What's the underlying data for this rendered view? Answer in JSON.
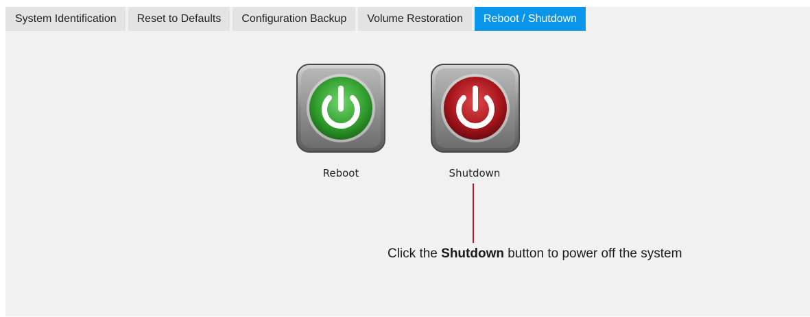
{
  "tabs": [
    {
      "label": "System Identification",
      "active": false
    },
    {
      "label": "Reset to Defaults",
      "active": false
    },
    {
      "label": "Configuration Backup",
      "active": false
    },
    {
      "label": "Volume Restoration",
      "active": false
    },
    {
      "label": "Reboot / Shutdown",
      "active": true
    }
  ],
  "buttons": {
    "reboot": {
      "label": "Reboot",
      "icon": "power-icon",
      "color": "#3fa83a"
    },
    "shutdown": {
      "label": "Shutdown",
      "icon": "power-icon",
      "color": "#b3141c"
    }
  },
  "callout": {
    "prefix": "Click the ",
    "emphasis": "Shutdown",
    "suffix": " button to power off the system",
    "line_color": "#c8102e"
  },
  "colors": {
    "active_tab": "#0a96ea",
    "inactive_tab": "#e3e3e3",
    "panel_bg": "#f1f1f1"
  }
}
